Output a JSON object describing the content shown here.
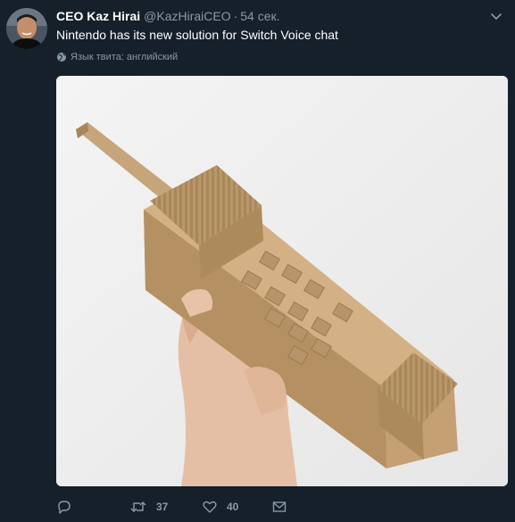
{
  "tweet": {
    "author_name": "CEO Kaz Hirai",
    "handle": "@KazHiraiCEO",
    "separator": "·",
    "time": "54 сек.",
    "text": "Nintendo has its new solution for Switch Voice chat",
    "language_note": "Язык твита: английский"
  },
  "actions": {
    "reply": {
      "icon": "reply-icon"
    },
    "retweet": {
      "icon": "retweet-icon",
      "count": "37"
    },
    "like": {
      "icon": "heart-icon",
      "count": "40"
    },
    "message": {
      "icon": "envelope-icon"
    }
  },
  "colors": {
    "background": "#15202b",
    "name": "#ffffff",
    "secondary_text": "#8899a6"
  }
}
